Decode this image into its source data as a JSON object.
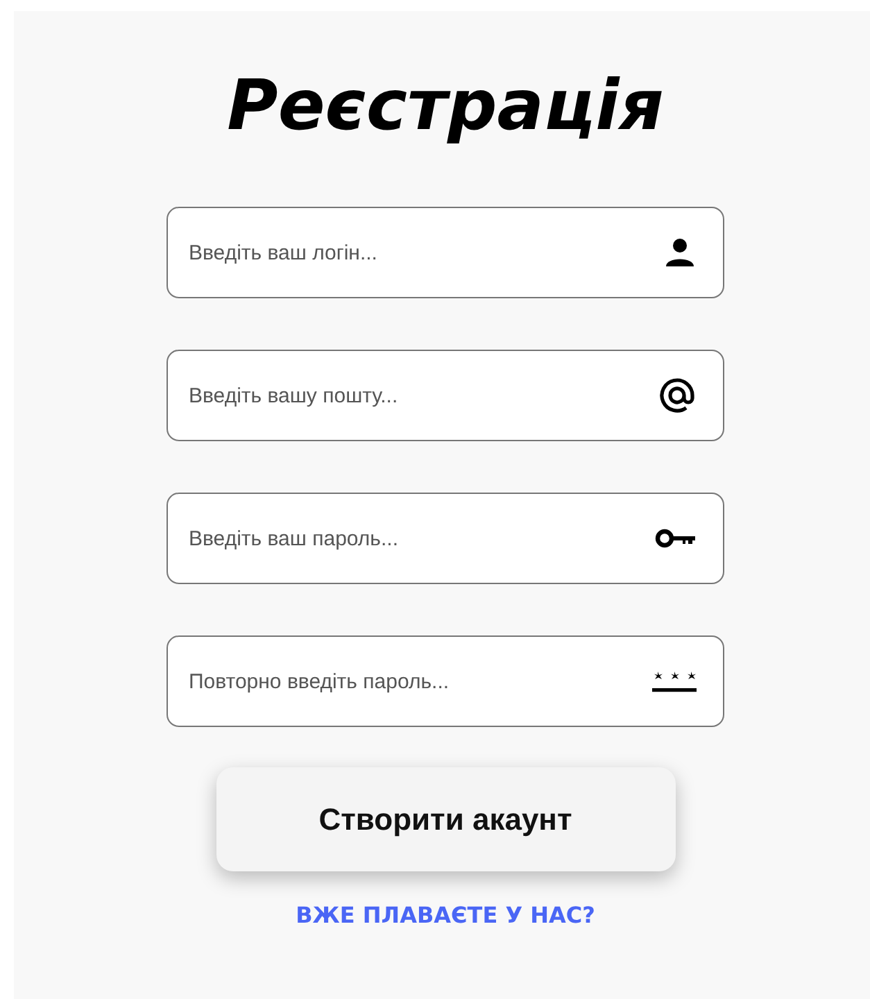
{
  "title": "Реєстрація",
  "fields": [
    {
      "kind": "login",
      "placeholder": "Введіть ваш логін..."
    },
    {
      "kind": "email",
      "placeholder": "Введіть вашу пошту..."
    },
    {
      "kind": "password",
      "placeholder": "Введіть ваш пароль..."
    },
    {
      "kind": "repeat",
      "placeholder": "Повторно введіть пароль..."
    }
  ],
  "submit_button": "Створити акаунт",
  "login_link": "ВЖЕ ПЛАВАЄТЕ У НАС?"
}
